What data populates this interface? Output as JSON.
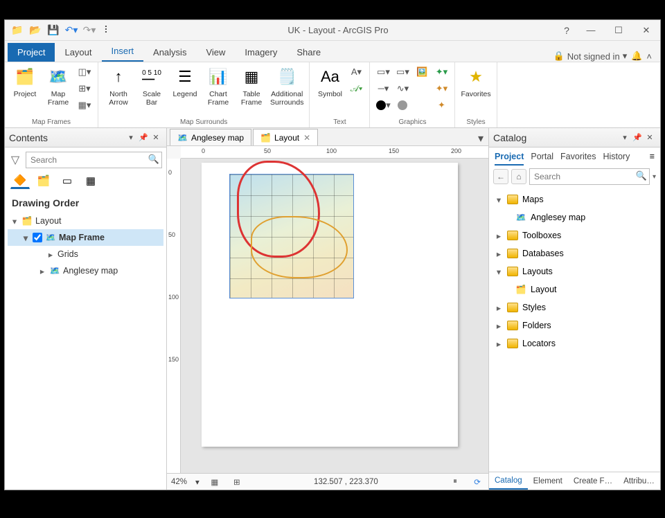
{
  "title": "UK - Layout - ArcGIS Pro",
  "signin": "Not signed in",
  "tabs": {
    "project": "Project",
    "layout": "Layout",
    "insert": "Insert",
    "analysis": "Analysis",
    "view": "View",
    "imagery": "Imagery",
    "share": "Share"
  },
  "ribbon": {
    "groups": {
      "map_frames": "Map Frames",
      "map_surrounds": "Map Surrounds",
      "text": "Text",
      "graphics": "Graphics",
      "styles": "Styles"
    },
    "btns": {
      "project": "Project",
      "map_frame": "Map\nFrame",
      "north_arrow": "North\nArrow",
      "scale_bar": "Scale\nBar",
      "legend": "Legend",
      "chart_frame": "Chart\nFrame",
      "table_frame": "Table\nFrame",
      "additional_surrounds": "Additional\nSurrounds",
      "symbol": "Symbol",
      "favorites": "Favorites"
    }
  },
  "contents": {
    "title": "Contents",
    "search_placeholder": "Search",
    "section": "Drawing Order",
    "layout": "Layout",
    "map_frame": "Map Frame",
    "grids": "Grids",
    "anglesey": "Anglesey map"
  },
  "doctabs": {
    "anglesey": "Anglesey map",
    "layout": "Layout"
  },
  "ruler": {
    "r0": "0",
    "r50": "50",
    "r100": "100",
    "r150": "150",
    "r200": "200"
  },
  "status": {
    "zoom": "42%",
    "coords": "132.507 , 223.370"
  },
  "catalog": {
    "title": "Catalog",
    "tabs": {
      "project": "Project",
      "portal": "Portal",
      "favorites": "Favorites",
      "history": "History"
    },
    "search_placeholder": "Search",
    "maps": "Maps",
    "anglesey": "Anglesey map",
    "toolboxes": "Toolboxes",
    "databases": "Databases",
    "layouts": "Layouts",
    "layout": "Layout",
    "styles": "Styles",
    "folders": "Folders",
    "locators": "Locators"
  },
  "bottom_tabs": {
    "catalog": "Catalog",
    "element": "Element",
    "create": "Create F…",
    "attrib": "Attribu…"
  }
}
